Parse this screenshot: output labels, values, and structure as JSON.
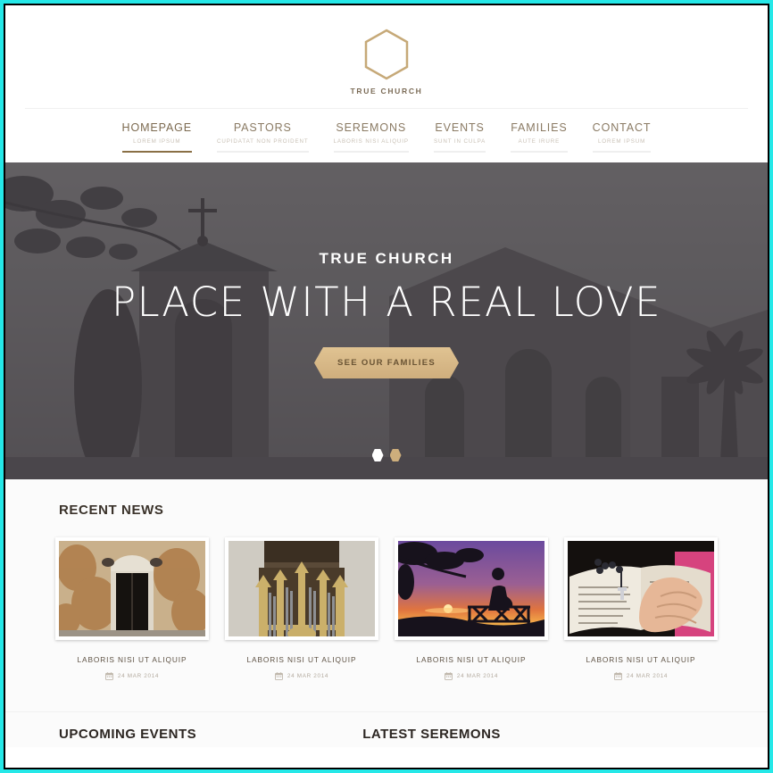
{
  "brand": {
    "logo_icon": "hexagon-cross-icon",
    "name": "TRUE CHURCH",
    "accent_color": "#8a7046",
    "logo_color": "#c6a978"
  },
  "nav": {
    "items": [
      {
        "label": "HOMEPAGE",
        "sub": "LOREM IPSUM",
        "active": true
      },
      {
        "label": "PASTORS",
        "sub": "CUPIDATAT NON PROIDENT",
        "active": false
      },
      {
        "label": "SEREMONS",
        "sub": "LABORIS NISI ALIQUIP",
        "active": false
      },
      {
        "label": "EVENTS",
        "sub": "SUNT IN CULPA",
        "active": false
      },
      {
        "label": "FAMILIES",
        "sub": "AUTE IRURE",
        "active": false
      },
      {
        "label": "CONTACT",
        "sub": "LOREM IPSUM",
        "active": false
      }
    ]
  },
  "hero": {
    "kicker": "TRUE CHURCH",
    "title": "PLACE WITH A REAL LOVE",
    "button_label": "SEE OUR FAMILIES",
    "image_description": "church bell tower with cross, tree branches, desaturated",
    "slides": [
      {
        "index": 1,
        "active": true
      },
      {
        "index": 2,
        "active": false
      }
    ]
  },
  "news": {
    "heading": "RECENT NEWS",
    "cards": [
      {
        "title": "LABORIS NISI UT ALIQUIP",
        "date": "24 MAR 2014",
        "date_icon": "calendar-icon",
        "image": "church-door"
      },
      {
        "title": "LABORIS NISI UT ALIQUIP",
        "date": "24 MAR 2014",
        "date_icon": "calendar-icon",
        "image": "pipe-organ"
      },
      {
        "title": "LABORIS NISI UT ALIQUIP",
        "date": "24 MAR 2014",
        "date_icon": "calendar-icon",
        "image": "sunset-silhouette"
      },
      {
        "title": "LABORIS NISI UT ALIQUIP",
        "date": "24 MAR 2014",
        "date_icon": "calendar-icon",
        "image": "praying-hands-bible"
      }
    ]
  },
  "bottom": {
    "events_heading": "UPCOMING EVENTS",
    "sermons_heading": "LATEST SEREMONS"
  }
}
